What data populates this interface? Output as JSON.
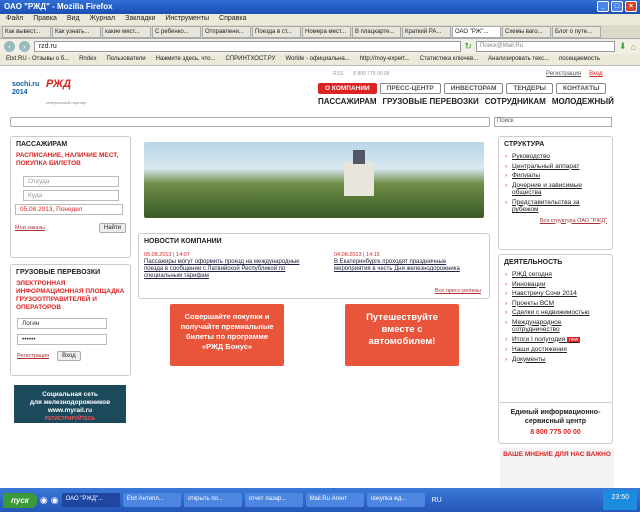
{
  "window": {
    "title": "ОАО \"РЖД\" - Mozilla Firefox"
  },
  "menu": [
    "Файл",
    "Правка",
    "Вид",
    "Журнал",
    "Закладки",
    "Инструменты",
    "Справка"
  ],
  "tabs": [
    "Как вывест...",
    "Как узнать...",
    "какие мест...",
    "С ребенко...",
    "Отправлени...",
    "Поезда в ст...",
    "Номера мест...",
    "В плацкарте...",
    "Краткий РА...",
    "ОАО \"РЖ\"...",
    "Схемы ваго...",
    "Блог о путе..."
  ],
  "nav": {
    "url": "rzd.ru",
    "search_placeholder": "Поиск@Mail.Ru"
  },
  "bookmarks": [
    "Etxt.RU - Отзывы о б...",
    "Rndex",
    "Пользователи",
    "Нажмите здесь, что...",
    "СПРИНТХОСТ.РУ",
    "Worlde - официальна...",
    "http://moy-expert...",
    "Статистика ключев...",
    "Анализировать текс...",
    "посещаемость"
  ],
  "top": {
    "small": [
      "RSS",
      "8 800 775 00 00"
    ],
    "register": "Регистрация",
    "login": "Вход",
    "nav1": [
      "О КОМПАНИИ",
      "ПРЕСС-ЦЕНТР",
      "ИНВЕСТОРАМ",
      "ТЕНДЕРЫ",
      "КОНТАКТЫ"
    ],
    "nav2": [
      "ПАССАЖИРАМ",
      "ГРУЗОВЫЕ ПЕРЕВОЗКИ",
      "СОТРУДНИКАМ",
      "МОЛОДЕЖНЫЙ"
    ],
    "search_label": "Поиск"
  },
  "logo": {
    "sochi": "sochi.ru 2014",
    "rzd": "РЖД",
    "partner": "генеральный партнер"
  },
  "passengers": {
    "title": "ПАССАЖИРАМ",
    "subtitle": "РАСПИСАНИЕ, НАЛИЧИЕ МЕСТ, ПОКУПКА БИЛЕТОВ",
    "from": "Откуда",
    "to": "Куда",
    "date": "05.08.2013, Понедел",
    "my_trips": "Мои заказы",
    "find": "Найти"
  },
  "cargo": {
    "title": "ГРУЗОВЫЕ ПЕРЕВОЗКИ",
    "subtitle": "ЭЛЕКТРОННАЯ ИНФОРМАЦИОННАЯ ПЛОЩАДКА ГРУЗООТПРАВИТЕЛЕЙ И ОПЕРАТОРОВ",
    "login": "Логин",
    "password": "••••••",
    "register": "Регистрация",
    "enter": "Вход"
  },
  "social": {
    "line1": "Социальная сеть",
    "line2": "для железнодорожников",
    "line3": "www.myrail.ru",
    "cta": "РЕГИСТРИРУЙТЕСЬ"
  },
  "news": {
    "title": "НОВОСТИ КОМПАНИИ",
    "items": [
      {
        "date": "05.08.2013 | 14:07",
        "text": "Пассажиры могут оформить проезд на международные поезда в сообщении с Латвийской Республикой по специальным тарифам"
      },
      {
        "date": "04.08.2013 | 14:15",
        "text": "В Екатеринбурге проходят праздничные мероприятия в честь Дня железнодорожника"
      }
    ],
    "all": "Все пресс-релизы"
  },
  "promo": {
    "bonus": "Совершайте покупки и получайте премиальные билеты по программе «РЖД Бонус»",
    "car": "Путешествуйте вместе с автомобилем!"
  },
  "structure": {
    "title": "СТРУКТУРА",
    "items": [
      "Руководство",
      "Центральный аппарат",
      "Филиалы",
      "Дочерние и зависимые общества",
      "Представительства за рубежом"
    ],
    "all": "Вся структура ОАО \"РЖД\""
  },
  "activity": {
    "title": "ДЕЯТЕЛЬНОСТЬ",
    "items": [
      "РЖД сегодня",
      "Инновации",
      "Навстречу Сочи 2014",
      "Проекты ВСМ",
      "Сделки с недвижимостью",
      "Международное сотрудничество",
      "Итоги I полугодия",
      "Наши достижения",
      "Документы"
    ],
    "badge": "new"
  },
  "service": {
    "title": "Единый информационно-сервисный центр",
    "phone": "8 800 775 00 00"
  },
  "opinion": {
    "text": "ВАШЕ МНЕНИЕ ДЛЯ НАС ВАЖНО"
  },
  "taskbar": {
    "start": "пуск",
    "tasks": [
      "ОАО \"РЖД\"...",
      "Etxt Антипл...",
      "открыть по...",
      "отчет лазар...",
      "Mail.Ru Агент",
      "покупка жд..."
    ],
    "lang": "RU",
    "time": "23:50"
  },
  "colors": {
    "accent": "#d22222",
    "promo": "#e8553a",
    "title_bar": "#2f6fd6"
  }
}
